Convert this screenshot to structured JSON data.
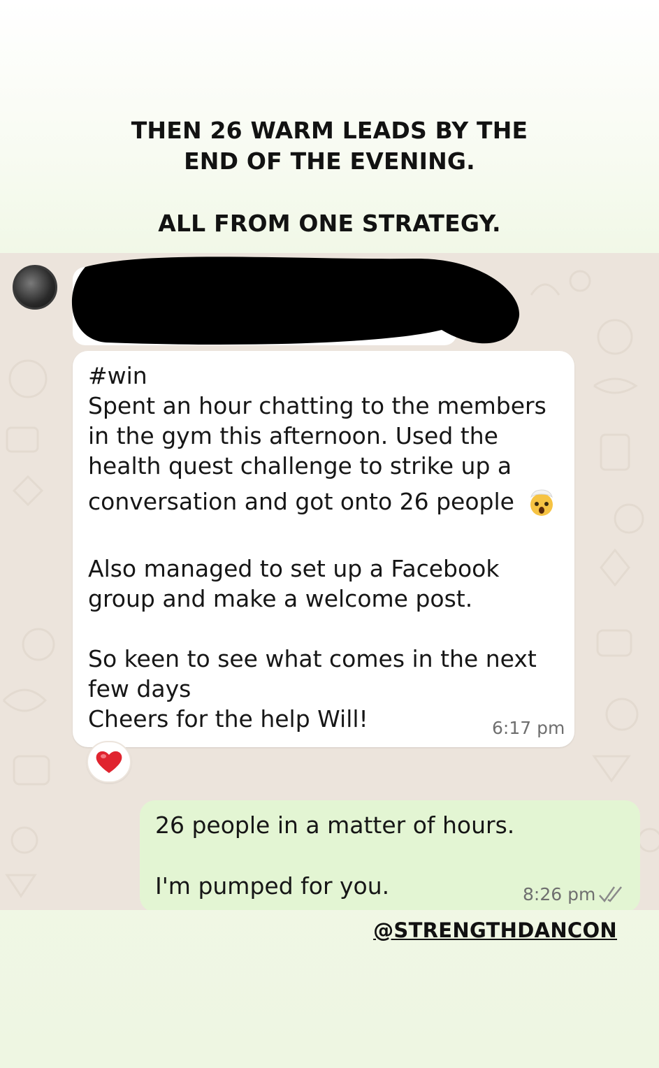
{
  "caption": {
    "line1": "THEN 26 WARM LEADS BY THE",
    "line2": "END OF THE EVENING.",
    "line3": "ALL FROM ONE STRATEGY."
  },
  "chat": {
    "incoming": {
      "lines": [
        "#win",
        "Spent an hour chatting to the members",
        "in the gym this afternoon. Used the",
        "health quest challenge to strike up a",
        "conversation and got onto 26 people",
        "Also managed to set up a Facebook",
        "group and make a welcome post.",
        "So keen to see what comes in the next",
        "few days",
        "Cheers for the help Will!"
      ],
      "emoji": "exploding-head-emoji",
      "time": "6:17 pm",
      "reaction": "heart-icon"
    },
    "outgoing": {
      "line1": "26 people in a matter of hours.",
      "line2": "I'm pumped for you.",
      "time": "8:26 pm",
      "status_icon": "double-check-icon"
    }
  },
  "handle": "@STRENGTHDANCON",
  "colors": {
    "chat_wallpaper": "#ece4dc",
    "outgoing_bubble": "#e3f5d3",
    "incoming_bubble": "#ffffff",
    "reaction_heart": "#e0242f",
    "read_ticks": "#8a8a8a"
  }
}
